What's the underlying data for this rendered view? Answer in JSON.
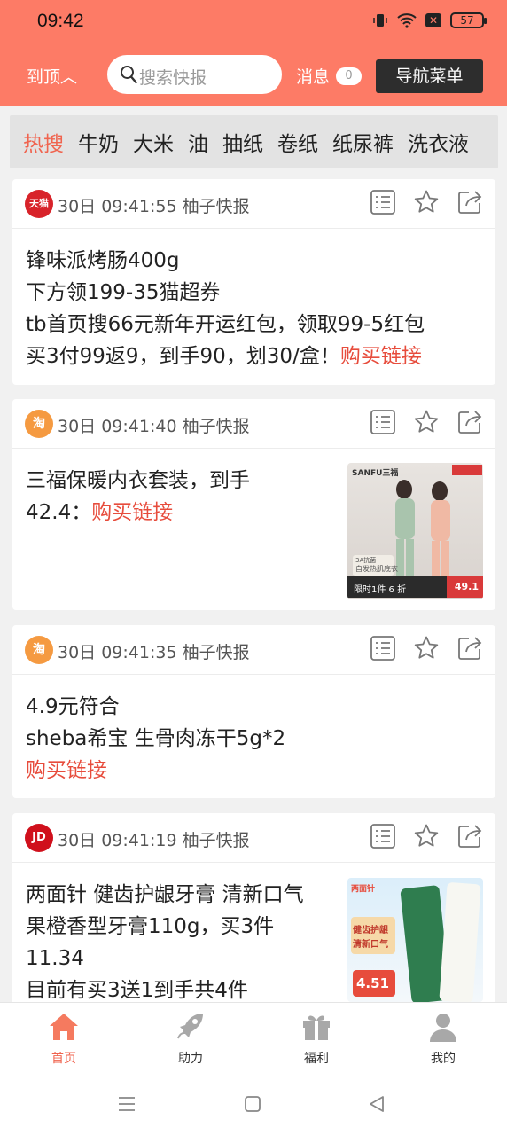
{
  "status": {
    "time": "09:42",
    "battery": "57"
  },
  "header": {
    "to_top": "到顶︿",
    "search_placeholder": "搜索快报",
    "messages_label": "消息",
    "messages_count": "0",
    "nav_menu": "导航菜单"
  },
  "categories": [
    "热搜",
    "牛奶",
    "大米",
    "油",
    "抽纸",
    "卷纸",
    "纸尿裤",
    "洗衣液"
  ],
  "cards": [
    {
      "source": "天猫",
      "meta": "30日 09:41:55 柚子快报",
      "lines": [
        "锋味派烤肠400g",
        "下方领199-35猫超券",
        "tb首页搜66元新年开运红包，领取99-5红包",
        "买3付99返9，到手90，划30/盒！"
      ],
      "link": "购买链接"
    },
    {
      "source": "淘",
      "meta": "30日 09:41:40 柚子快报",
      "lines": [
        "三福保暖内衣套装，到手",
        "42.4："
      ],
      "link": "购买链接",
      "thumb": {
        "brand": "SANFU三福",
        "badge": "限时1件 6 折",
        "price": "49.1",
        "tag": "3A抗菌",
        "caption": "自发热肌底衣"
      }
    },
    {
      "source": "淘",
      "meta": "30日 09:41:35 柚子快报",
      "lines": [
        "4.9元符合",
        "sheba希宝 生骨肉冻干5g*2"
      ],
      "link": "购买链接"
    },
    {
      "source": "JD",
      "meta": "30日 09:41:19 柚子快报",
      "lines": [
        "两面针 健齿护龈牙膏 清新口气",
        "果橙香型牙膏110g，买3件",
        "11.34",
        "目前有买3送1到手共4件"
      ],
      "thumb": {
        "brand": "两面针",
        "tag1": "健齿护龈",
        "tag2": "清新口气",
        "price": "4.51"
      }
    }
  ],
  "bottom_nav": [
    {
      "label": "首页",
      "icon": "home-icon"
    },
    {
      "label": "助力",
      "icon": "rocket-icon"
    },
    {
      "label": "福利",
      "icon": "gift-icon"
    },
    {
      "label": "我的",
      "icon": "user-icon"
    }
  ],
  "colors": {
    "header": "#fd7b66",
    "accent": "#f0644f",
    "link": "#e74c3c"
  }
}
